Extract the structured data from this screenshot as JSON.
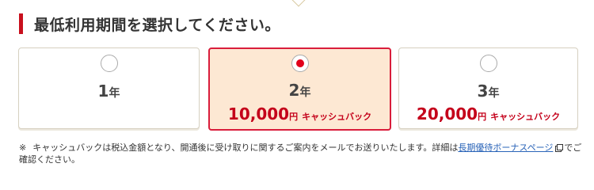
{
  "heading": {
    "title": "最低利用期間を選択してください。"
  },
  "plans": [
    {
      "years": "1",
      "unit": "年",
      "selected": false,
      "cashback_amount": "",
      "cashback_yen": "",
      "cashback_label": ""
    },
    {
      "years": "2",
      "unit": "年",
      "selected": true,
      "cashback_amount": "10,000",
      "cashback_yen": "円",
      "cashback_label": "キャッシュバック"
    },
    {
      "years": "3",
      "unit": "年",
      "selected": false,
      "cashback_amount": "20,000",
      "cashback_yen": "円",
      "cashback_label": "キャッシュバック"
    }
  ],
  "note": {
    "mark": "※",
    "text": "キャッシュバックは税込金額となり、開通後に受け取りに関するご案内をメールでお送りいたします。詳細は",
    "link": "長期優待ボーナスページ",
    "after_link": "でご確認ください。"
  },
  "colors": {
    "accent_red": "#c8101d",
    "selected_border": "#d91d3b",
    "selected_bg": "#fde8d3",
    "cashback_text": "#c4001a",
    "link": "#2a64b8"
  },
  "icons": {
    "radio_selected": "radio-dot-icon",
    "external_link": "external-link-icon"
  }
}
